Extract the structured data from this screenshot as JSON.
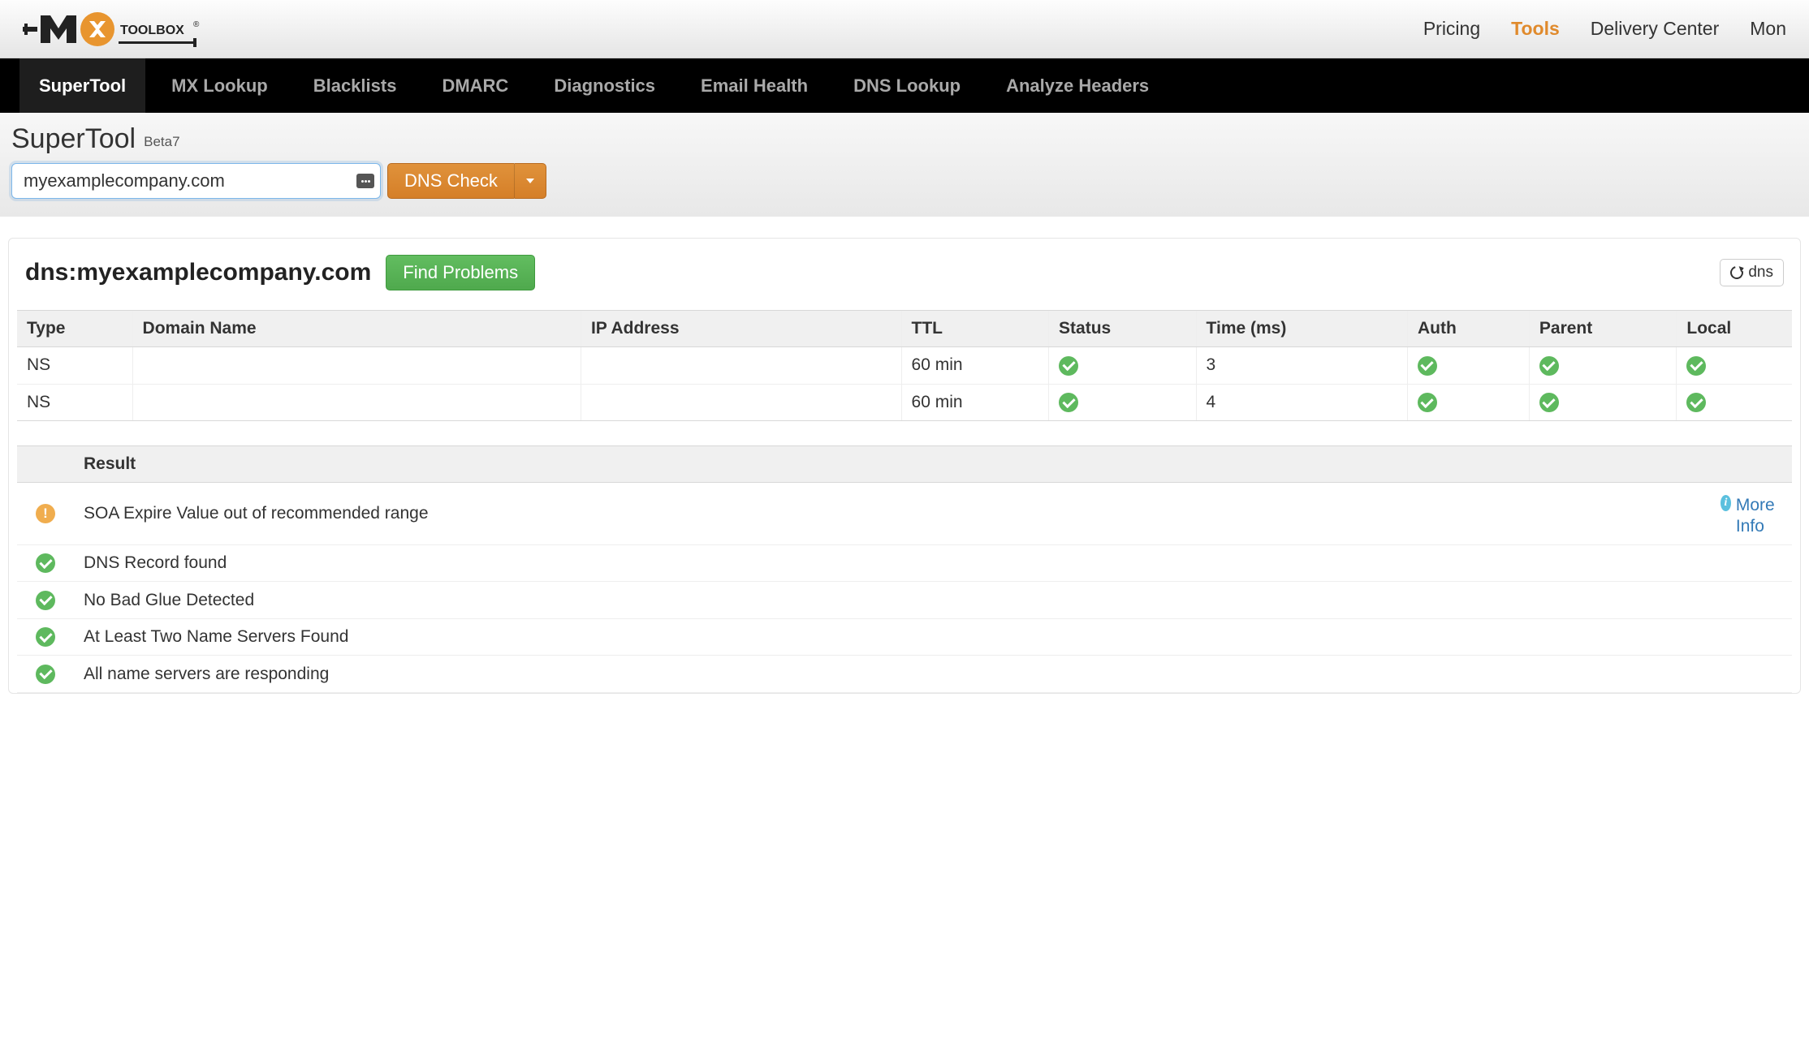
{
  "brand": {
    "name": "MXTOOLBOX",
    "reg": "®"
  },
  "top_nav": {
    "pricing": "Pricing",
    "tools": "Tools",
    "delivery_center": "Delivery Center",
    "mon": "Mon"
  },
  "secondary_nav": {
    "items": [
      "SuperTool",
      "MX Lookup",
      "Blacklists",
      "DMARC",
      "Diagnostics",
      "Email Health",
      "DNS Lookup",
      "Analyze Headers"
    ]
  },
  "page": {
    "title": "SuperTool",
    "badge": "Beta7"
  },
  "search": {
    "value": "myexamplecompany.com",
    "button": "DNS Check"
  },
  "result": {
    "title": "dns:myexamplecompany.com",
    "find_problems": "Find Problems",
    "refresh_label": "dns"
  },
  "table": {
    "headers": {
      "type": "Type",
      "domain": "Domain Name",
      "ip": "IP Address",
      "ttl": "TTL",
      "status": "Status",
      "time": "Time (ms)",
      "auth": "Auth",
      "parent": "Parent",
      "local": "Local"
    },
    "rows": [
      {
        "type": "NS",
        "domain": "",
        "ip": "",
        "ttl": "60 min",
        "status": "ok",
        "time": "3",
        "auth": "ok",
        "parent": "ok",
        "local": "ok"
      },
      {
        "type": "NS",
        "domain": "",
        "ip": "",
        "ttl": "60 min",
        "status": "ok",
        "time": "4",
        "auth": "ok",
        "parent": "ok",
        "local": "ok"
      }
    ]
  },
  "results_list": {
    "header": "Result",
    "more_info": "More Info",
    "items": [
      {
        "status": "warn",
        "text": "SOA Expire Value out of recommended range",
        "has_more": true
      },
      {
        "status": "ok",
        "text": "DNS Record found",
        "has_more": false
      },
      {
        "status": "ok",
        "text": "No Bad Glue Detected",
        "has_more": false
      },
      {
        "status": "ok",
        "text": "At Least Two Name Servers Found",
        "has_more": false
      },
      {
        "status": "ok",
        "text": "All name servers are responding",
        "has_more": false
      }
    ]
  }
}
